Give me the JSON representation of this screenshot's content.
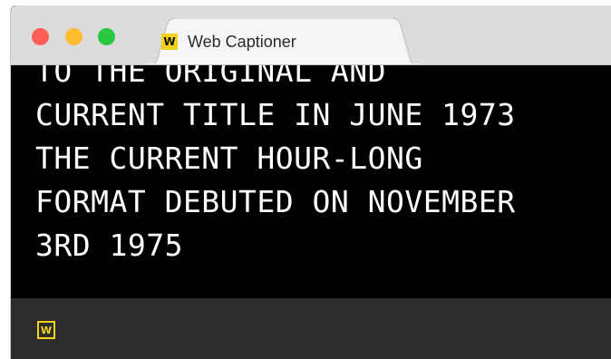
{
  "window": {
    "traffic_lights": {
      "close_color": "#fd5f57",
      "minimize_color": "#febc2e",
      "zoom_color": "#28c840"
    }
  },
  "tab": {
    "title": "Web Captioner",
    "favicon_letter": "W",
    "favicon_color": "#f4d21c"
  },
  "captions": {
    "lines": [
      "TO THE ORIGINAL AND",
      "CURRENT TITLE IN JUNE 1973",
      "THE CURRENT HOUR-LONG",
      "FORMAT DEBUTED ON NOVEMBER",
      "3RD 1975"
    ],
    "text_color": "#ffffff",
    "background": "#000000"
  },
  "toolbar": {
    "logo_letter": "W",
    "logo_color": "#f4d21c",
    "background": "#2d2d2d"
  }
}
